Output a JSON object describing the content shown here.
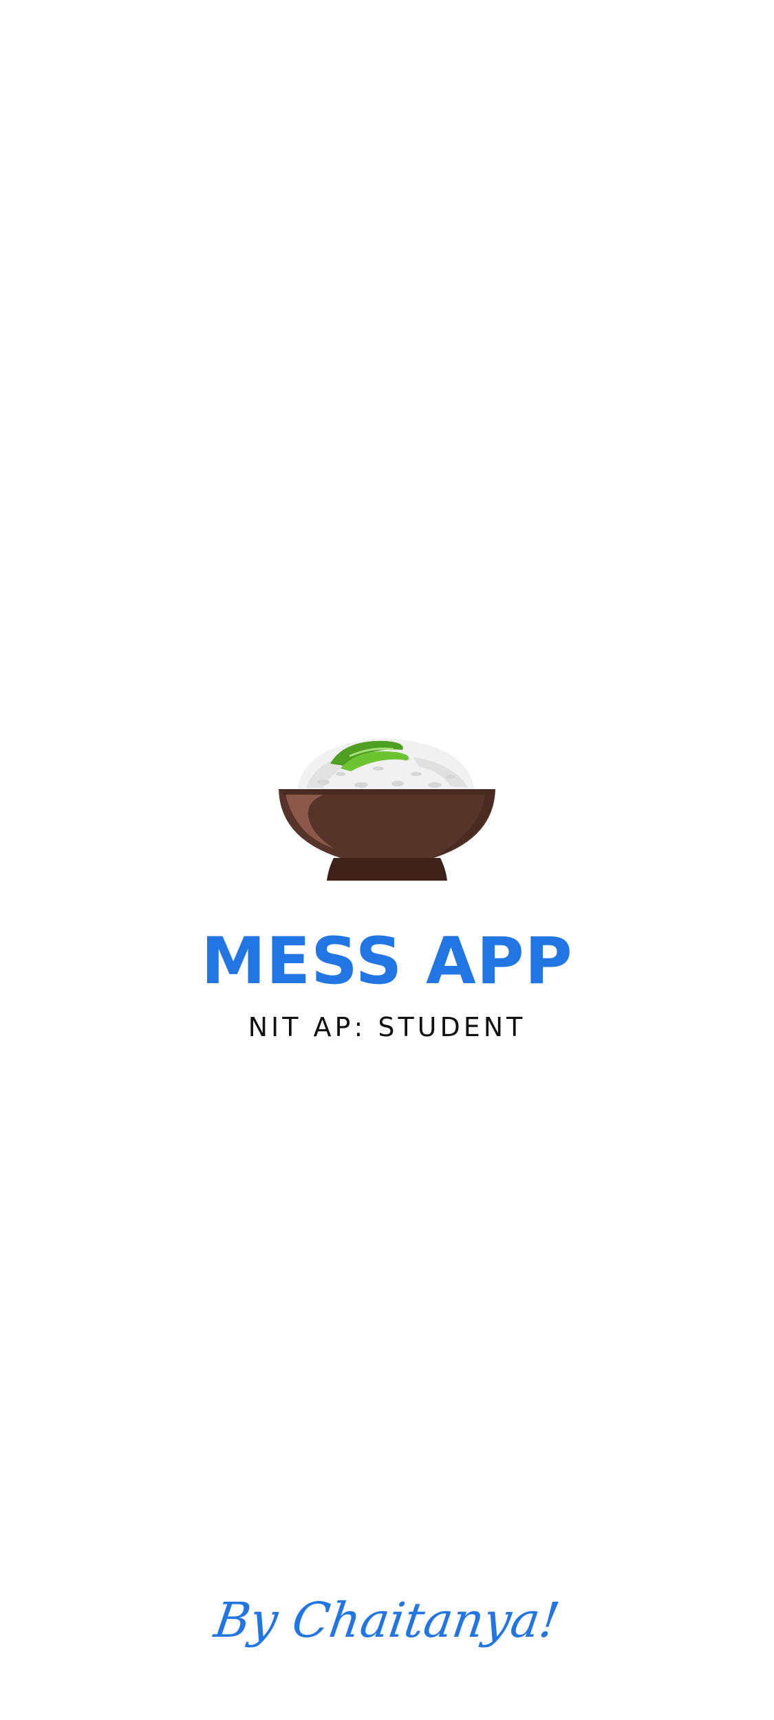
{
  "app": {
    "title": "MESS APP",
    "subtitle": "NIT AP: STUDENT",
    "credit": "By Chaitanya!",
    "logo_icon": "rice-bowl-icon"
  },
  "colors": {
    "background": "#ffffff",
    "accent": "#2276e3",
    "subtitle_text": "#111111",
    "bowl_main": "#573429",
    "bowl_shadow": "#3e221a",
    "bowl_highlight": "#8b5849",
    "rice": "#f2f2f2",
    "garnish": "#5db52a"
  }
}
